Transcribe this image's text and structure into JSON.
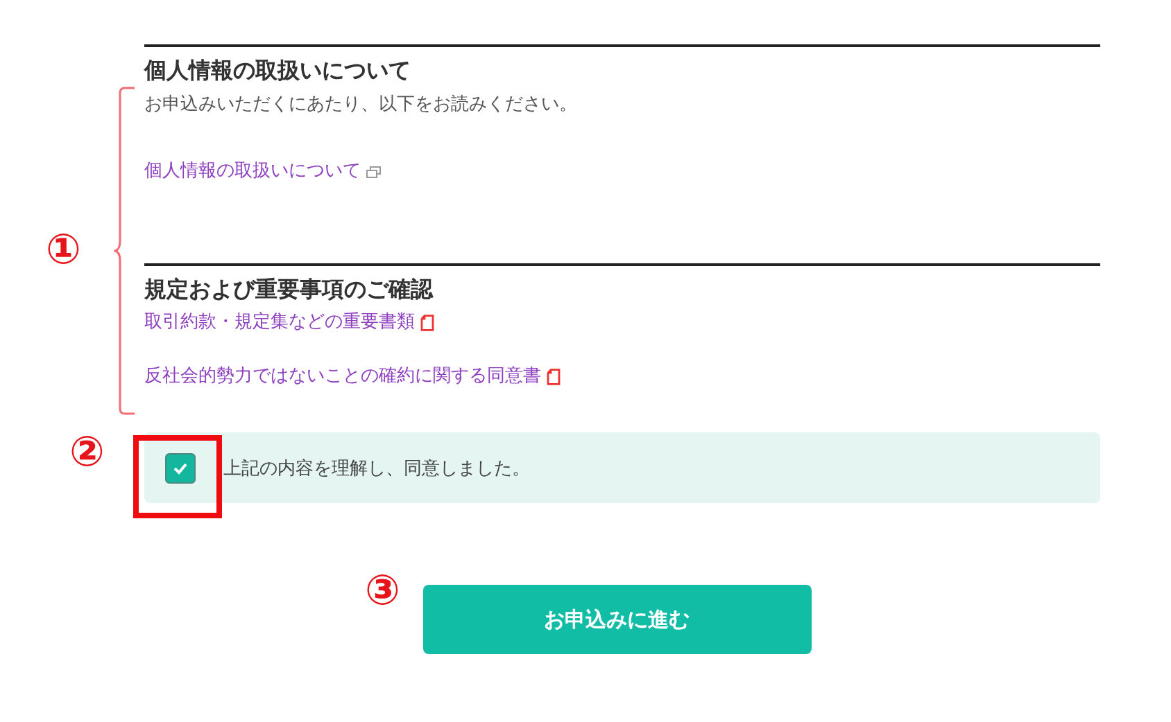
{
  "sections": [
    {
      "title": "個人情報の取扱いについて",
      "description": "お申込みいただくにあたり、以下をお読みください。",
      "links": [
        {
          "label": "個人情報の取扱いについて",
          "kind": "window"
        }
      ]
    },
    {
      "title": "規定および重要事項のご確認",
      "links": [
        {
          "label": "取引約款・規定集などの重要書類",
          "kind": "pdf"
        },
        {
          "label": "反社会的勢力ではないことの確約に関する同意書",
          "kind": "pdf"
        }
      ]
    }
  ],
  "agreement": {
    "label": "上記の内容を理解し、同意しました。",
    "checked": true
  },
  "submit_button": "お申込みに進む",
  "annotations": [
    "①",
    "②",
    "③"
  ]
}
